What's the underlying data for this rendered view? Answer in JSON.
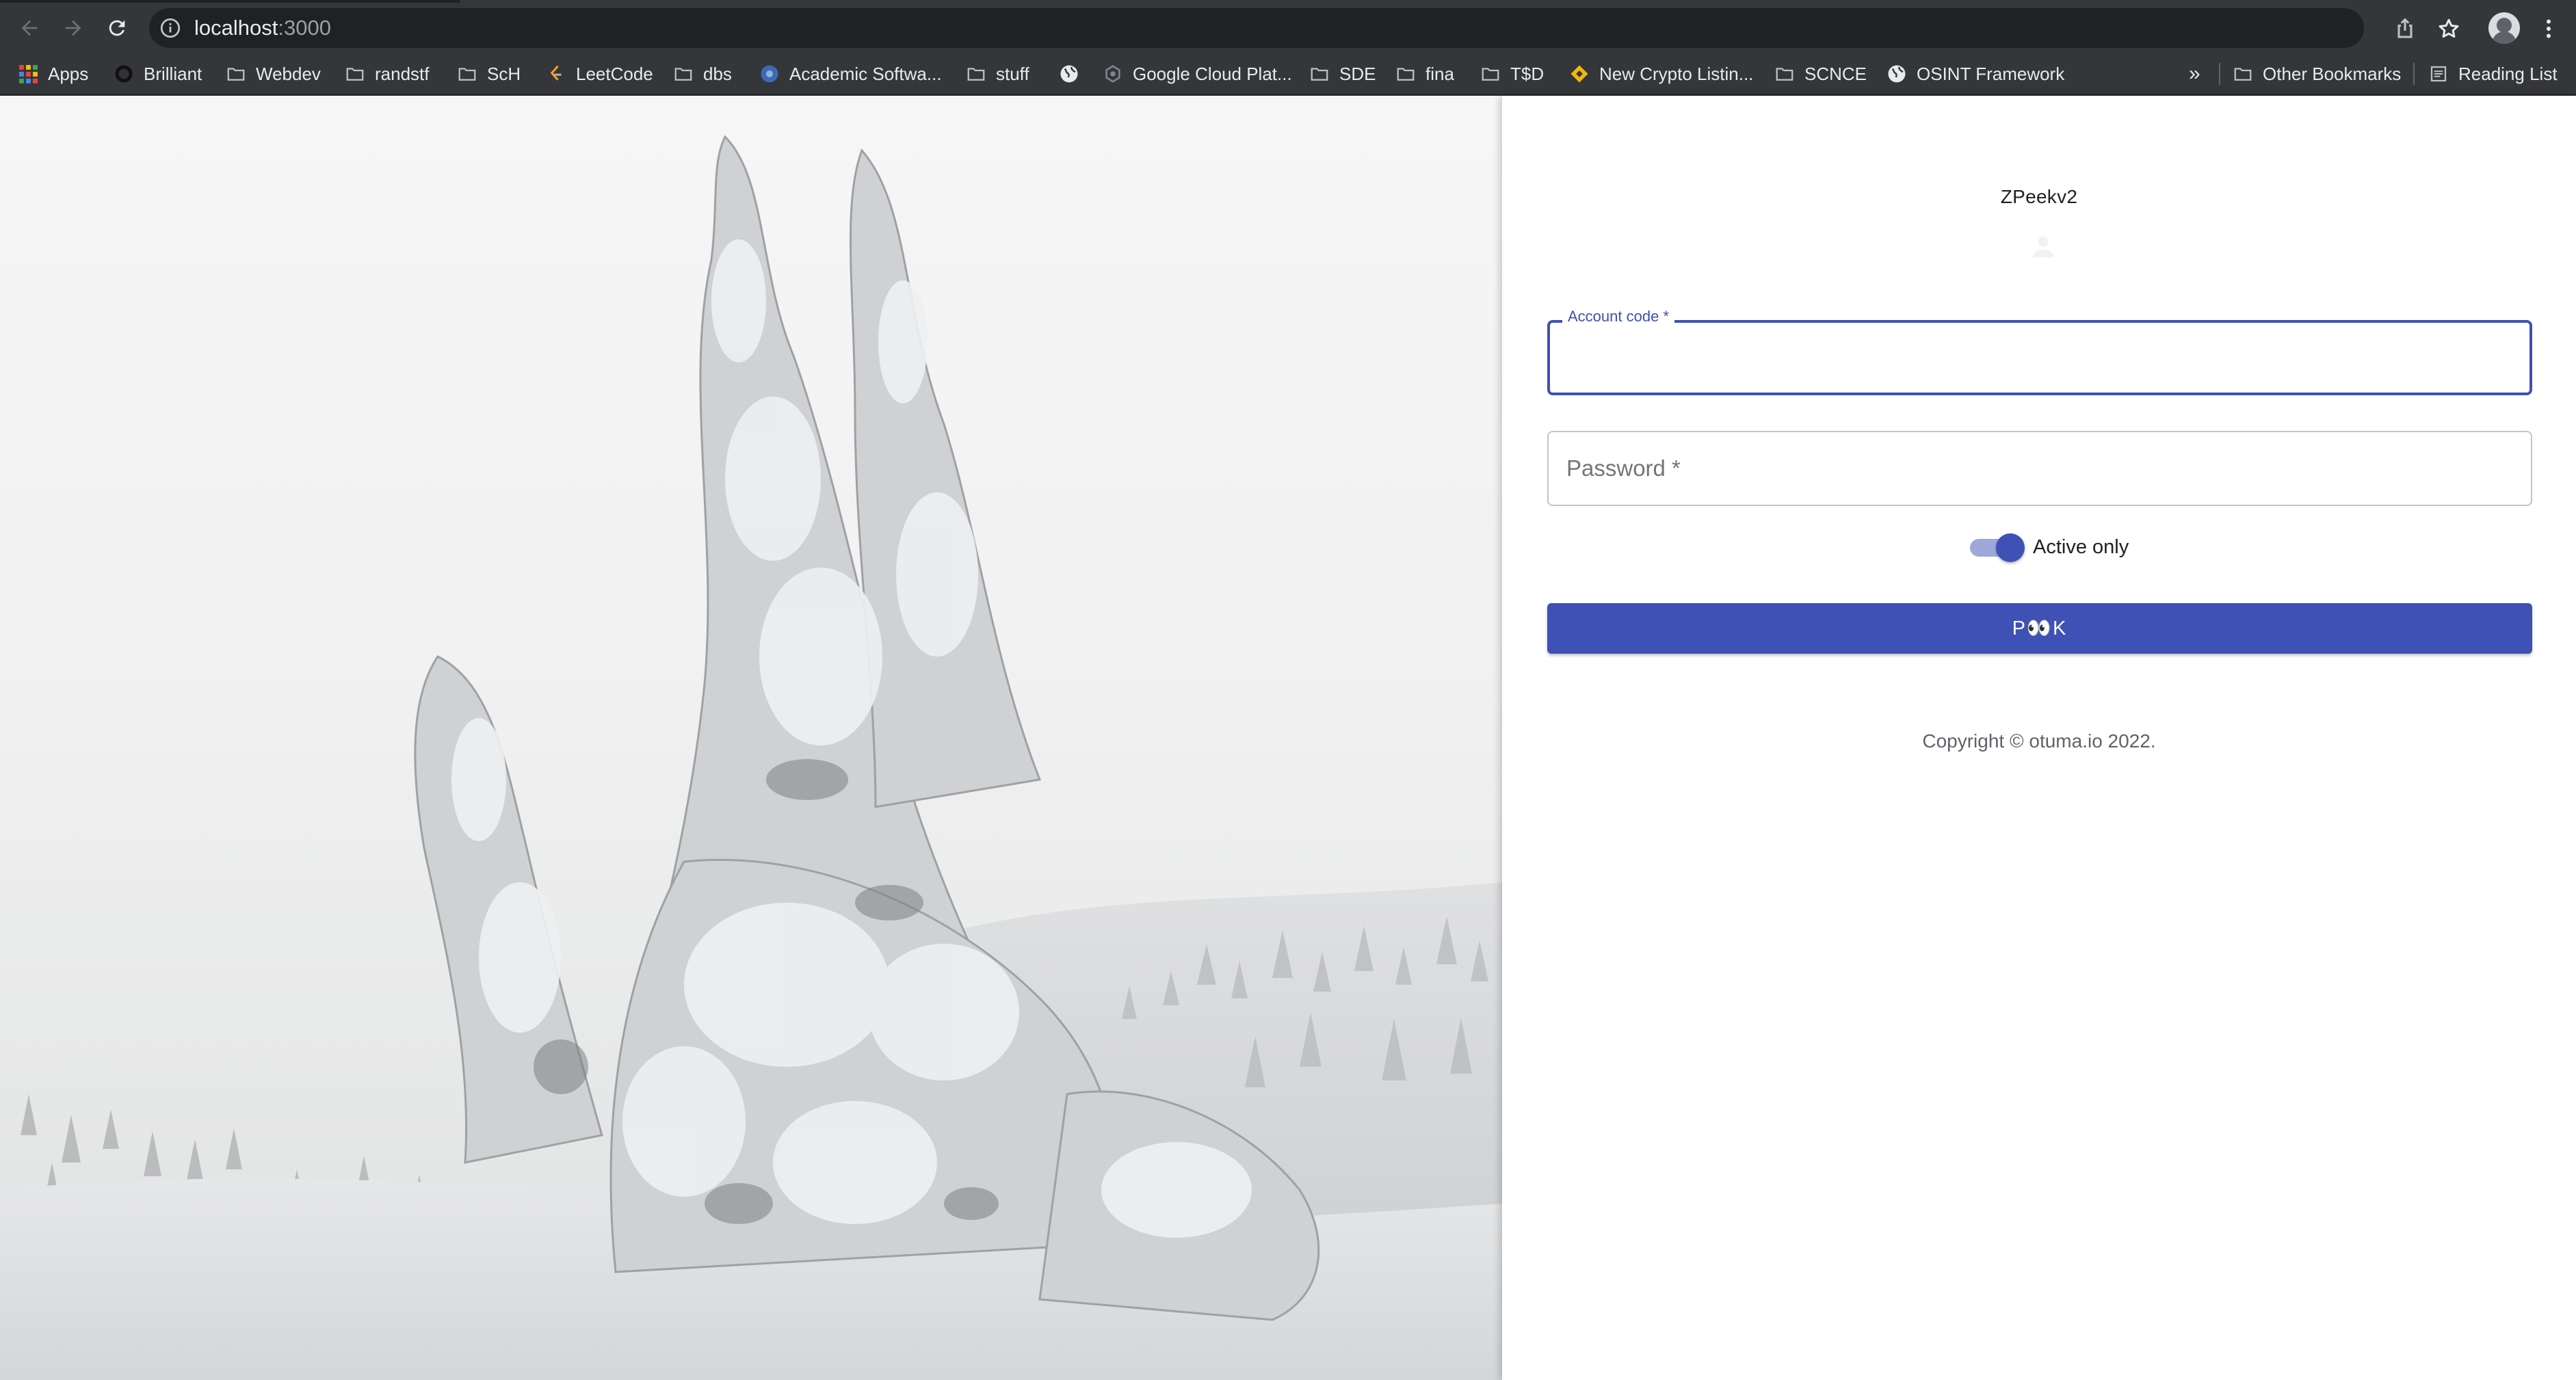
{
  "browser": {
    "url_host": "localhost",
    "url_port": ":3000",
    "icons": [
      "back-arrow-icon",
      "forward-arrow-icon",
      "reload-icon",
      "info-icon",
      "share-icon",
      "star-icon",
      "profile-avatar-icon",
      "kebab-menu-icon"
    ]
  },
  "bookmarks": {
    "items": [
      {
        "label": "Apps",
        "icon": "apps-grid-icon"
      },
      {
        "label": "Brilliant",
        "icon": "site-favicon"
      },
      {
        "label": "Webdev",
        "icon": "folder-icon"
      },
      {
        "label": "randstf",
        "icon": "folder-icon"
      },
      {
        "label": "ScH",
        "icon": "folder-icon"
      },
      {
        "label": "LeetCode",
        "icon": "leetcode-icon"
      },
      {
        "label": "dbs",
        "icon": "folder-icon"
      },
      {
        "label": "Academic Softwa...",
        "icon": "academic-favicon"
      },
      {
        "label": "stuff",
        "icon": "folder-icon"
      },
      {
        "label": "",
        "icon": "globe-icon"
      },
      {
        "label": "Google Cloud Plat...",
        "icon": "gcp-icon"
      },
      {
        "label": "SDE",
        "icon": "folder-icon"
      },
      {
        "label": "fina",
        "icon": "folder-icon"
      },
      {
        "label": "T$D",
        "icon": "folder-icon"
      },
      {
        "label": "New Crypto Listin...",
        "icon": "binance-icon"
      },
      {
        "label": "SCNCE",
        "icon": "folder-icon"
      },
      {
        "label": "OSINT Framework",
        "icon": "globe-icon"
      }
    ],
    "overflow": "»",
    "other_bookmarks": "Other Bookmarks",
    "reading_list": "Reading List"
  },
  "login": {
    "app_title": "ZPeekv2",
    "account_label": "Account code *",
    "account_value": "",
    "password_placeholder": "Password *",
    "toggle_label": "Active only",
    "toggle_on": true,
    "submit_label": "P👀K",
    "copyright": "Copyright © otuma.io 2022."
  },
  "colors": {
    "primary": "#3f51b5",
    "primary_light": "#9fa8da",
    "chrome_dark": "#202124",
    "chrome_mid": "#35363a"
  }
}
